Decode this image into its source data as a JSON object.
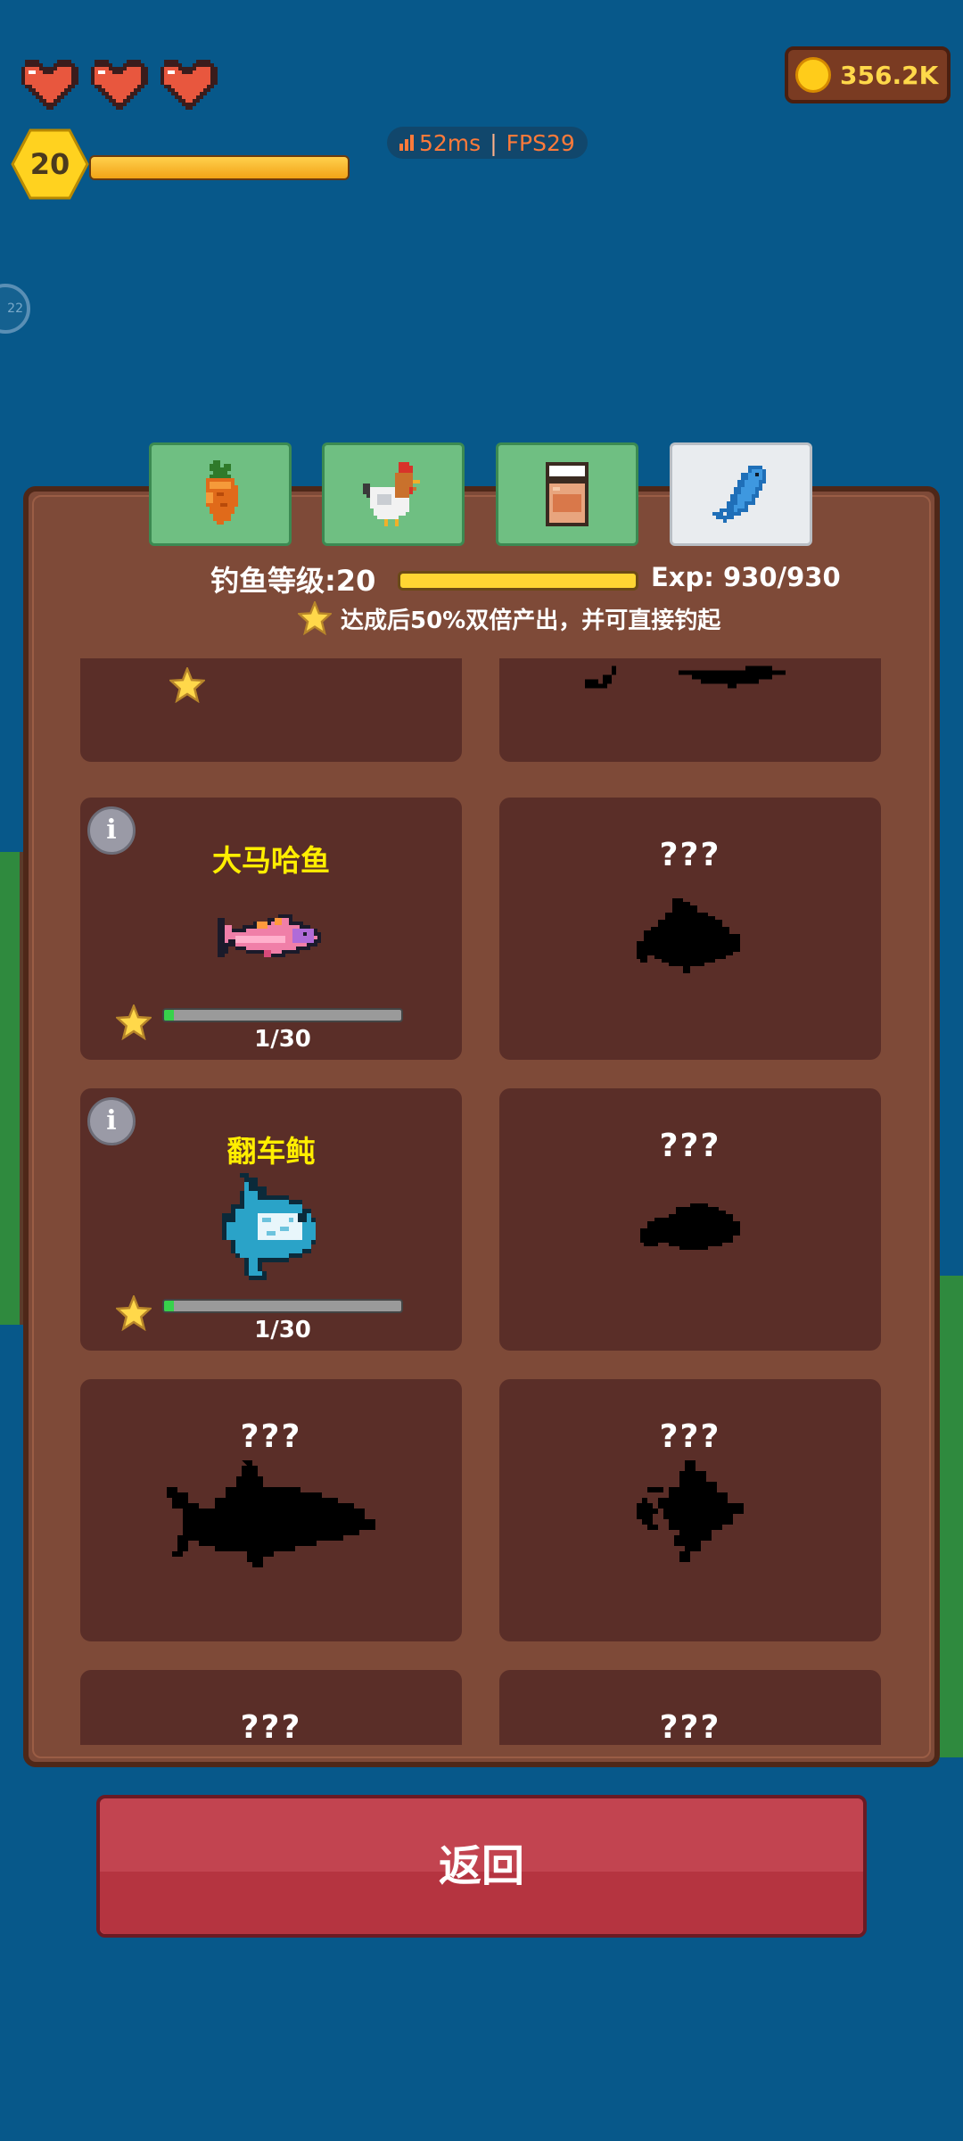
{
  "hud": {
    "hearts": 3,
    "player_level": "20",
    "xp_progress": 1.0,
    "ping": "52ms",
    "fps": "FPS29",
    "side_badge": "22",
    "coins": "356.2K"
  },
  "tabs": [
    {
      "icon": "carrot-icon",
      "active": false
    },
    {
      "icon": "chicken-icon",
      "active": false
    },
    {
      "icon": "jar-icon",
      "active": false
    },
    {
      "icon": "fish-icon",
      "active": true
    }
  ],
  "panel": {
    "level_label": "钓鱼等级:20",
    "level_progress": 1.0,
    "exp_label": "Exp: 930/930",
    "hint": "达成后50%双倍产出，并可直接钓起"
  },
  "fish_cards": [
    {
      "name": "大马哈鱼",
      "count": "1/30",
      "progress": 0.04,
      "info": "i"
    },
    {
      "name": "???"
    },
    {
      "name": "翻车鲀",
      "count": "1/30",
      "progress": 0.04,
      "info": "i"
    },
    {
      "name": "???"
    },
    {
      "name": "???"
    },
    {
      "name": "???"
    },
    {
      "name": "???"
    },
    {
      "name": "???"
    }
  ],
  "back_button": "返回",
  "colors": {
    "water": "#07588a",
    "panel": "#7e4a38",
    "card": "#5a2e28",
    "button": "#c24450",
    "name_yellow": "#ffee00"
  }
}
